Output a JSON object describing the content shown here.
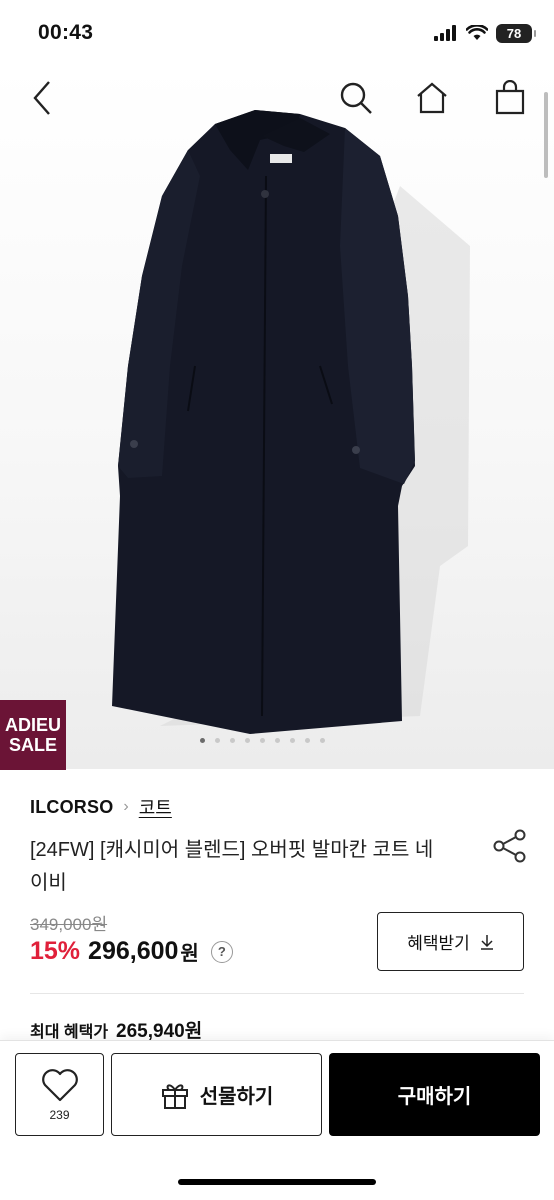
{
  "status_bar": {
    "time": "00:43",
    "battery": "78"
  },
  "badge": {
    "line1": "ADIEU",
    "line2": "SALE"
  },
  "product": {
    "brand": "ILCORSO",
    "category": "코트",
    "title": "[24FW] [캐시미어 블렌드] 오버핏 발마칸 코트 네이비",
    "original_price": "349,000원",
    "discount": "15%",
    "sale_price": "296,600",
    "currency": "원",
    "help": "?",
    "benefit_button": "혜택받기",
    "max_benefit_label": "최대 혜택가",
    "max_benefit_amount": "265,940원"
  },
  "bottom_bar": {
    "like_count": "239",
    "gift_label": "선물하기",
    "buy_label": "구매하기"
  },
  "colors": {
    "accent": "#e0203a",
    "badge_bg": "#6b1436",
    "coat": "#151826"
  },
  "carousel": {
    "current": 1,
    "total": 9
  },
  "icons": [
    "back-icon",
    "search-icon",
    "home-icon",
    "shopping-bag-icon",
    "share-icon",
    "heart-icon",
    "gift-icon",
    "download-icon"
  ]
}
